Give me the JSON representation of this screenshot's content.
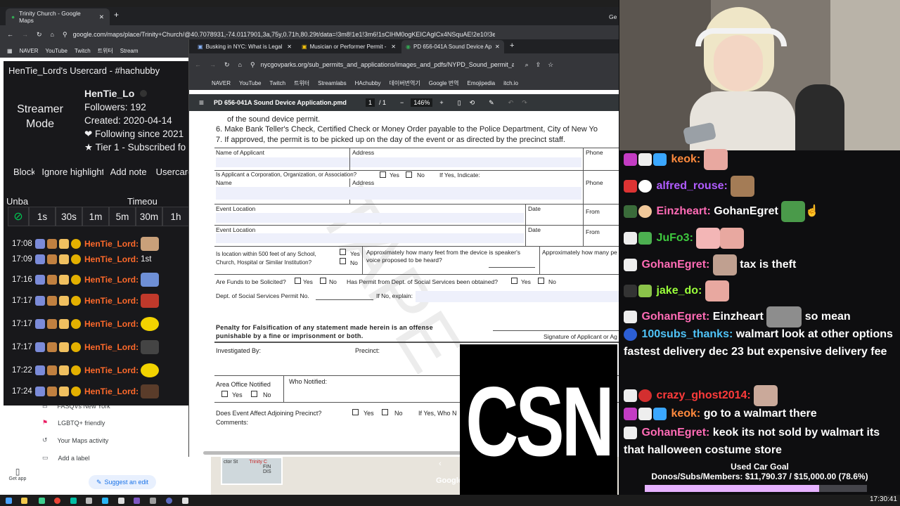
{
  "browser_main": {
    "tabs": [
      "Trinity Church - Google Maps",
      "Ge"
    ],
    "url": "google.com/maps/place/Trinity+Church/@40.7078931,-74.0117901,3a,75y,0.71h,80.29t/data=!3m8!1e1!3m6!1sCIHM0ogKEICAgICx4NSquAE!2e10!3e11!6s...",
    "bookmarks": [
      "NAVER",
      "YouTube",
      "Twitch",
      "트위터",
      "Stream"
    ]
  },
  "maps": {
    "items": [
      "FASQVs New York",
      "LGBTQ+ friendly",
      "Your Maps activity",
      "Add a label"
    ],
    "get_app": "Get app",
    "suggest_edit": "Suggest an edit",
    "map_label": "ctor St",
    "map_label2": "Trinity C",
    "map_label3": "FIN DIS",
    "google": "Google"
  },
  "usercard": {
    "title": "HenTie_Lord's Usercard - #hachubby",
    "mode": "Streamer Mode",
    "name": "HenTie_Lo",
    "followers": "Followers: 192",
    "created": "Created: 2020-04-14",
    "following": "❤ Following since 2021",
    "tier": "★ Tier 1 - Subscribed fo",
    "actions": [
      "Block",
      "Ignore highlight",
      "Add note",
      "Usercard"
    ],
    "unban": "Unba",
    "timeout": "Timeou",
    "timeout_buttons": [
      "1s",
      "30s",
      "1m",
      "5m",
      "30m",
      "1h"
    ],
    "log_name": "HenTie_Lord:",
    "log": [
      {
        "time": "17:08",
        "msg": ""
      },
      {
        "time": "17:09",
        "msg": "1st"
      },
      {
        "time": "17:16",
        "msg": ""
      },
      {
        "time": "17:17",
        "msg": ""
      },
      {
        "time": "17:17",
        "msg": ""
      },
      {
        "time": "17:17",
        "msg": ""
      },
      {
        "time": "17:22",
        "msg": ""
      },
      {
        "time": "17:24",
        "msg": ""
      }
    ]
  },
  "pdf_browser": {
    "tabs": [
      "Busking in NYC: What is Legal o",
      "Musician or Performer Permit -",
      "PD 656-041A Sound Device Ap"
    ],
    "url": "nycgovparks.org/sub_permits_and_applications/images_and_pdfs/NYPD_Sound_permit_a...",
    "bookmarks": [
      "NAVER",
      "YouTube",
      "Twitch",
      "트위터",
      "Streamlabs",
      "HAchubby",
      "데이버번역기",
      "Google 번역",
      "Emojipedia",
      "itch.io"
    ],
    "doc_title": "PD 656-041A Sound Device Application.pmd",
    "page": "1",
    "pages": "/  1",
    "zoom": "146%"
  },
  "form": {
    "line_top": "of the sound device permit.",
    "item6": "6.  Make Bank Teller's Check, Certified Check or Money Order payable to the Police Department, City of New Yo",
    "item7": "7.  If approved, the permit is to be picked up on the day of the event or as directed by the precinct staff.",
    "name_of_applicant": "Name of Applicant",
    "address": "Address",
    "phone": "Phone",
    "corp_q": "Is Applicant a Corporation, Organization, or Association?",
    "yes": "Yes",
    "no": "No",
    "if_yes": "If Yes, Indicate:",
    "name": "Name",
    "event_location": "Event Location",
    "date": "Date",
    "from": "From",
    "within500": "Is location within 500 feet of any School, Church, Hospital or Similar Institution?",
    "approx_feet": "Approximately how many feet from the device is speaker's voice proposed to be heard?",
    "approx_many": "Approximately how many pe",
    "funds": "Are Funds to be Solicited?",
    "has_permit": "Has Permit from Dept. of Social Services been obtained?",
    "dss_permit": "Dept. of Social Services Permit No.",
    "if_no": "If No, explain:",
    "penalty": "Penalty for Falsification of any statement made herein is an offense punishable by a fine or imprisonment or both.",
    "signature": "Signature of Applicant or Ag",
    "investigated": "Investigated By:",
    "precinct": "Precinct:",
    "area_office": "Area Office Notified",
    "who_notified": "Who Notified:",
    "adjoining": "Does Event Affect Adjoining Precinct?",
    "if_yes_who": "If Yes, Who N",
    "comments": "Comments:"
  },
  "overlay": {
    "logo_text": "CSN"
  },
  "chat": [
    {
      "user": "keok:",
      "color": "#ff8a3d",
      "text": ""
    },
    {
      "user": "alfred_rouse:",
      "color": "#b05cff",
      "text": ""
    },
    {
      "user": "Einzheart:",
      "color": "#ff6bb5",
      "text": "GohanEgret"
    },
    {
      "user": "JuFo3:",
      "color": "#3ec83e",
      "text": ""
    },
    {
      "user": "GohanEgret:",
      "color": "#ff6bb5",
      "text": "tax is theft"
    },
    {
      "user": "jake_do:",
      "color": "#9aff3a",
      "text": ""
    },
    {
      "user": "GohanEgret:",
      "color": "#ff6bb5",
      "text": "Einzheart"
    },
    {
      "user": "",
      "color": "#ffffff",
      "text": "so mean"
    },
    {
      "user": "100subs_thanks:",
      "color": "#4fc3f7",
      "text": "walmart look at other options fastest delivery dec 23 but expensive delivery fee"
    },
    {
      "user": "crazy_ghost2014:",
      "color": "#ff3b3b",
      "text": ""
    },
    {
      "user": "keok:",
      "color": "#ff8a3d",
      "text": "go to a walmart there"
    },
    {
      "user": "GohanEgret:",
      "color": "#ff6bb5",
      "text": "keok its not sold by walmart its that halloween costume store"
    }
  ],
  "goal": {
    "title": "Used Car Goal",
    "detail": "Donos/Subs/Members: $11,790.37 / $15,000.00 (78.6%)",
    "progress": 0.786
  },
  "taskbar": {
    "time": "17:30:41"
  }
}
